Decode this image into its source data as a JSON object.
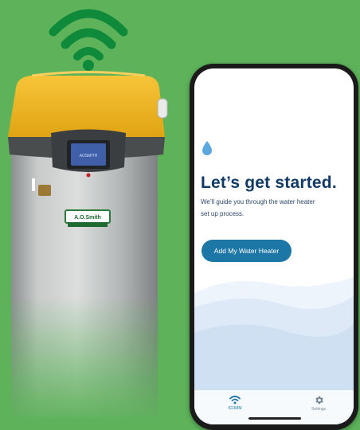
{
  "colors": {
    "background": "#5db25a",
    "wifi_signal": "#0f8a3a",
    "heater_top": "#f2b51d",
    "title": "#113a66",
    "button": "#1c77a6"
  },
  "heater": {
    "brand_label": "A.O.Smith",
    "display_text": "AOSMITH"
  },
  "app": {
    "title": "Let’s get started.",
    "subtitle": "We’ll guide you through the water heater set up process.",
    "cta_label": "Add My Water Heater",
    "nav": [
      {
        "label": "ICOMM",
        "icon": "wifi-icon",
        "active": true
      },
      {
        "label": "Settings",
        "icon": "gear-icon",
        "active": false
      }
    ]
  }
}
